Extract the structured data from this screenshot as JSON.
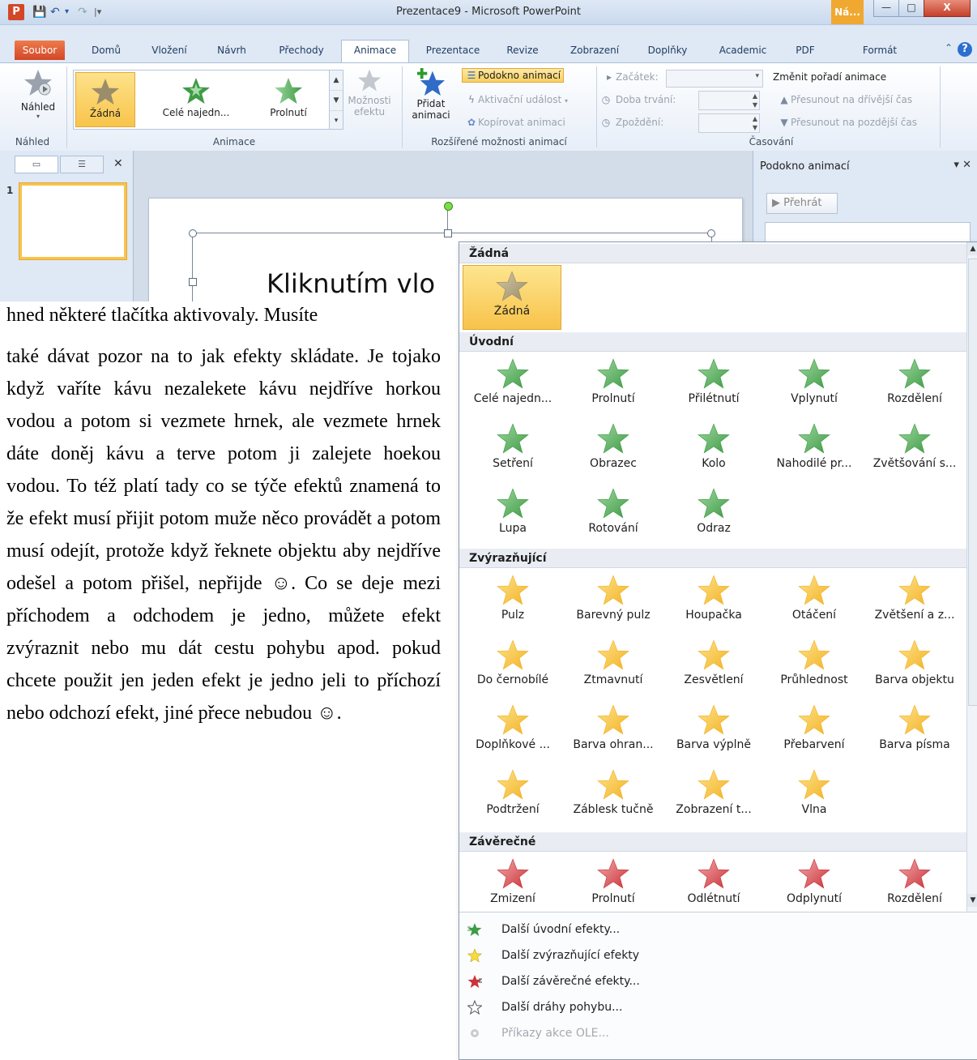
{
  "window": {
    "title": "Prezentace9 - Microsoft PowerPoint",
    "app_icon": "P",
    "context_tab": "Ná...",
    "buttons": {
      "minimize": "—",
      "maximize": "□",
      "close": "X"
    }
  },
  "tabs": [
    "Soubor",
    "Domů",
    "Vložení",
    "Návrh",
    "Přechody",
    "Animace",
    "Prezentace",
    "Revize",
    "Zobrazení",
    "Doplňky",
    "Academic",
    "PDF",
    "Formát"
  ],
  "ribbon": {
    "preview": {
      "label": "Náhled",
      "group": "Náhled"
    },
    "animation_group": "Animace",
    "gallery_items": [
      "Žádná",
      "Celé najedn...",
      "Prolnutí"
    ],
    "effect_options": {
      "line1": "Možnosti",
      "line2": "efektu"
    },
    "add_animation": {
      "line1": "Přidat",
      "line2": "animaci"
    },
    "animation_pane_btn": "Podokno animací",
    "trigger": "Aktivační událost",
    "painter": "Kopírovat animaci",
    "advanced_group": "Rozšířené možnosti animací",
    "start": "Začátek:",
    "duration": "Doba trvání:",
    "delay": "Zpoždění:",
    "reorder": "Změnit pořadí animace",
    "move_earlier": "Přesunout na dřívější čas",
    "move_later": "Přesunout na pozdější čas",
    "timing_group": "Časování"
  },
  "slide": {
    "number": "1",
    "title_text": "Kliknutím vlo"
  },
  "animation_pane": {
    "title": "Podokno animací",
    "play": "Přehrát"
  },
  "document": {
    "first_line": "hned některé tlačítka aktivovaly.  Musíte",
    "body": "také dávat pozor na to jak efekty skládate. Je tojako když vaříte kávu nezalekete kávu nejdříve horkou vodou a potom si vezmete hrnek, ale vezmete hrnek dáte doněj kávu a terve potom ji zalejete hoekou vodou. To též platí tady co se týče efektů znamená to že efekt musí přijit potom muže něco provádět a potom musí odejít, protože když řeknete objektu aby nejdříve odešel a potom přišel, nepřijde ☺. Co se deje mezi příchodem a odchodem je jedno, můžete efekt zvýraznit nebo mu dát cestu pohybu apod. pokud chcete použit jen jeden efekt je jedno jeli to příchozí nebo odchozí efekt, jiné přece nebudou ☺."
  },
  "dropdown": {
    "sections": {
      "none": "Žádná",
      "entrance": "Úvodní",
      "emphasis": "Zvýrazňující",
      "exit": "Závěrečné"
    },
    "none_items": [
      "Žádná"
    ],
    "entrance_items": [
      "Celé najedn...",
      "Prolnutí",
      "Přilétnutí",
      "Vplynutí",
      "Rozdělení",
      "Setření",
      "Obrazec",
      "Kolo",
      "Nahodilé pr...",
      "Zvětšování s...",
      "Lupa",
      "Rotování",
      "Odraz"
    ],
    "emphasis_items": [
      "Pulz",
      "Barevný pulz",
      "Houpačka",
      "Otáčení",
      "Zvětšení a z...",
      "Do černobílé",
      "Ztmavnutí",
      "Zesvětlení",
      "Průhlednost",
      "Barva objektu",
      "Doplňkové ...",
      "Barva ohran...",
      "Barva výplně",
      "Přebarvení",
      "Barva písma",
      "Podtržení",
      "Záblesk tučně",
      "Zobrazení t...",
      "Vlna"
    ],
    "exit_items": [
      "Zmizení",
      "Prolnutí",
      "Odlétnutí",
      "Odplynutí",
      "Rozdělení"
    ],
    "more": [
      "Další úvodní efekty...",
      "Další zvýrazňující efekty",
      "Další závěrečné efekty...",
      "Další dráhy pohybu...",
      "Příkazy akce OLE..."
    ]
  },
  "colors": {
    "entrance_green": "#3f9b45",
    "emphasis_gold": "#f3b226",
    "exit_red": "#c9343a",
    "selection": "#f8c44b"
  }
}
